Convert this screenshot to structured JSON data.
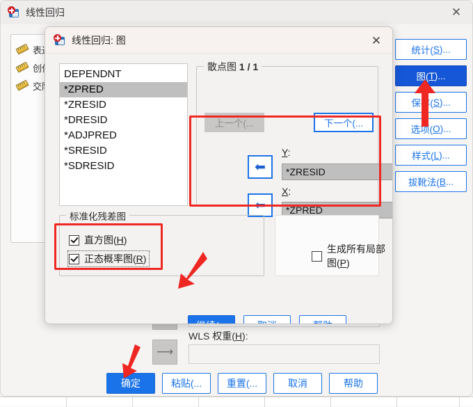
{
  "main_window": {
    "title": "线性回归",
    "icon": "spss-regression-icon",
    "close_label": "✕",
    "background_variables": [
      {
        "label": "表达",
        "icon": "ruler-icon"
      },
      {
        "label": "创作",
        "icon": "ruler-icon"
      },
      {
        "label": "交际",
        "icon": "ruler-icon"
      }
    ],
    "wls": {
      "label": "WLS 权重(H):",
      "label_prefix": "WLS ",
      "label_mid": "权重(",
      "label_accel": "H",
      "label_suffix": "):",
      "value": "",
      "arrow_icon": "right-arrow-icon"
    },
    "side_buttons": [
      {
        "text": "统计(S)...",
        "prefix": "统计(",
        "accel": "S",
        "suffix": ")...",
        "active": false
      },
      {
        "text": "图(T)...",
        "prefix": "图(",
        "accel": "T",
        "suffix": ")...",
        "active": true
      },
      {
        "text": "保存(S)...",
        "prefix": "保存(",
        "accel": "S",
        "suffix": ")...",
        "active": false
      },
      {
        "text": "选项(O)...",
        "prefix": "选项(",
        "accel": "O",
        "suffix": ")...",
        "active": false
      },
      {
        "text": "样式(L)...",
        "prefix": "样式(",
        "accel": "L",
        "suffix": ")...",
        "active": false
      },
      {
        "text": "拔靴法(B...",
        "prefix": "拔靴法(",
        "accel": "B",
        "suffix": "...",
        "active": false
      }
    ],
    "bottom_buttons": [
      {
        "text": "确定",
        "primary": true
      },
      {
        "text": "粘贴(...",
        "primary": false
      },
      {
        "text": "重置(...",
        "primary": false
      },
      {
        "text": "取消",
        "primary": false
      },
      {
        "text": "帮助",
        "primary": false
      }
    ]
  },
  "plots_dialog": {
    "title": "线性回归: 图",
    "icon": "spss-regression-icon",
    "close_label": "✕",
    "variables": [
      {
        "name": "DEPENDNT",
        "selected": false
      },
      {
        "name": "*ZPRED",
        "selected": true
      },
      {
        "name": "*ZRESID",
        "selected": false
      },
      {
        "name": "*DRESID",
        "selected": false
      },
      {
        "name": "*ADJPRED",
        "selected": false
      },
      {
        "name": "*SRESID",
        "selected": false
      },
      {
        "name": "*SDRESID",
        "selected": false
      }
    ],
    "scatter_group": {
      "legend_prefix": "散点图 ",
      "legend_counter": "1 / 1",
      "prev_button": {
        "text": "上一个(...",
        "enabled": false
      },
      "next_button": {
        "text": "下一个(...",
        "enabled": true
      },
      "y_axis": {
        "label_prefix": "",
        "label_accel": "Y",
        "label_suffix": ":",
        "value": "*ZRESID",
        "arrow_icon": "move-left-arrow-icon"
      },
      "x_axis": {
        "label_prefix": "",
        "label_accel": "X",
        "label_suffix": ":",
        "value": "*ZPRED",
        "arrow_icon": "move-left-arrow-icon"
      }
    },
    "residual_group": {
      "legend": "标准化残差图",
      "checkboxes": [
        {
          "prefix": "直方图(",
          "accel": "H",
          "suffix": ")",
          "checked": true,
          "focused": false
        },
        {
          "prefix": "正态概率图(",
          "accel": "R",
          "suffix": ")",
          "checked": true,
          "focused": true
        }
      ]
    },
    "produce_all_partial_plots": {
      "prefix": "生成所有局部图(",
      "accel": "P",
      "suffix": ")",
      "checked": false
    },
    "bottom_buttons": [
      {
        "text": "继续(...",
        "primary": true
      },
      {
        "text": "取消",
        "primary": false
      },
      {
        "text": "帮助",
        "primary": false
      }
    ]
  },
  "annotations": {
    "highlight_color": "#ee2722",
    "boxes": [
      {
        "name": "xy-fields-highlight"
      },
      {
        "name": "residual-checkboxes-highlight"
      }
    ],
    "arrows": [
      {
        "name": "arrow-to-plots-button",
        "direction": "up"
      },
      {
        "name": "arrow-to-continue-button",
        "direction": "down-left"
      },
      {
        "name": "arrow-to-ok-button",
        "direction": "down"
      }
    ]
  }
}
